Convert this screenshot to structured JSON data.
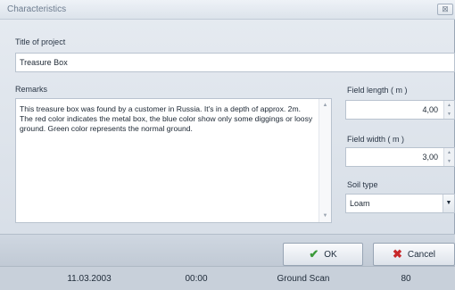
{
  "window": {
    "title": "Characteristics",
    "close_glyph": "⊠"
  },
  "project": {
    "title_label": "Title of project",
    "title_value": "Treasure Box"
  },
  "remarks": {
    "label": "Remarks",
    "text": "This treasure box was found by a customer in Russia. It's in a depth of approx. 2m. The red color indicates the metal box, the blue color show only some diggings or loosy ground. Green color represents the normal ground."
  },
  "field_length": {
    "label": "Field length ( m )",
    "value": "4,00"
  },
  "field_width": {
    "label": "Field width ( m )",
    "value": "3,00"
  },
  "soil": {
    "label": "Soil type",
    "value": "Loam"
  },
  "buttons": {
    "ok_label": "OK",
    "cancel_label": "Cancel"
  },
  "icons": {
    "ok": "check-icon",
    "cancel": "x-icon",
    "dropdown": "chevron-down-icon"
  },
  "status_row": {
    "date": "11.03.2003",
    "time": "00:00",
    "type": "Ground Scan",
    "value": "80"
  },
  "colors": {
    "ok_check": "#3c9a3a",
    "cancel_x": "#c8282a"
  }
}
